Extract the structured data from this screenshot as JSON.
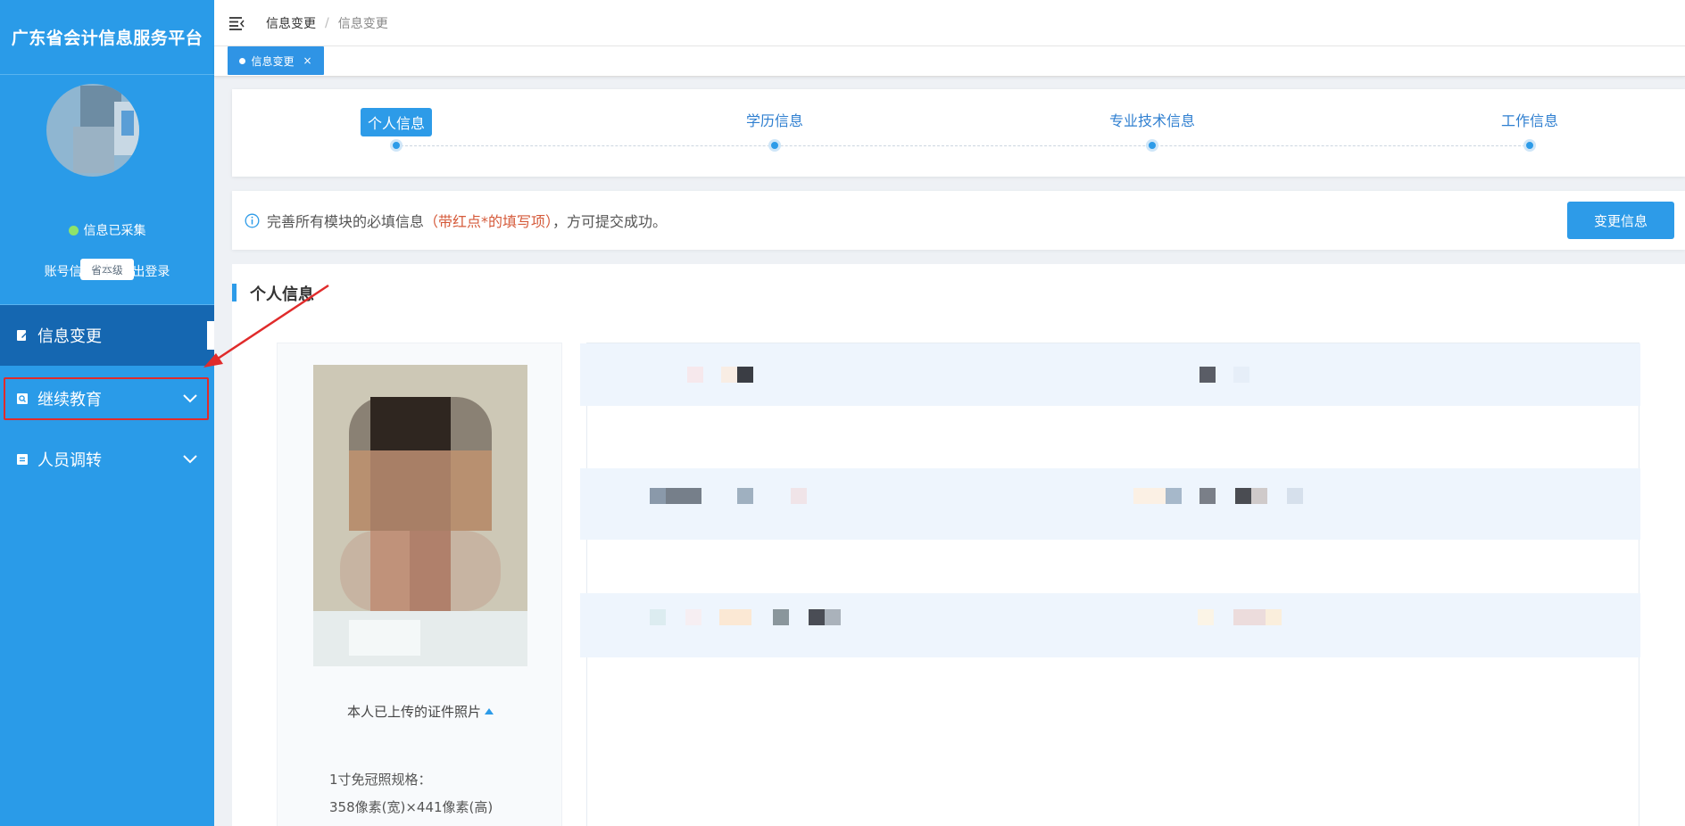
{
  "app": {
    "title": "广东省会计信息服务平台"
  },
  "profile": {
    "level": "省本级",
    "status": "信息已采集",
    "account_link": "账号信息",
    "separator": "|",
    "logout_link": "退出登录"
  },
  "sidebar": {
    "items": [
      {
        "label": "信息变更",
        "icon": "edit-icon",
        "active": true
      },
      {
        "label": "继续教育",
        "icon": "search-doc-icon",
        "active": false,
        "expandable": true
      },
      {
        "label": "人员调转",
        "icon": "list-doc-icon",
        "active": false,
        "expandable": true
      }
    ]
  },
  "topbar": {
    "menu_icon": "menu-fold-icon",
    "breadcrumb": [
      "信息变更",
      "信息变更"
    ],
    "breadcrumb_separator": "/"
  },
  "tabs": [
    {
      "label": "信息变更",
      "close": "×"
    }
  ],
  "steps": [
    {
      "label": "个人信息",
      "active": true
    },
    {
      "label": "学历信息",
      "active": false
    },
    {
      "label": "专业技术信息",
      "active": false
    },
    {
      "label": "工作信息",
      "active": false
    }
  ],
  "notice": {
    "icon": "info-circle-icon",
    "text_before": "完善所有模块的必填信息",
    "text_red": "（带红点*的填写项）",
    "text_after": "，方可提交成功。",
    "button": "变更信息"
  },
  "section": {
    "title": "个人信息",
    "photo_caption": "本人已上传的证件照片",
    "spec_line1": "1寸免冠照规格：",
    "spec_line2": "358像素(宽)×441像素(高)"
  },
  "colors": {
    "sidebar_bg": "#2a9be8",
    "sidebar_active": "#1567b1",
    "primary": "#2d9be8",
    "highlight": "#e02b2b",
    "notice_red": "#d55a3a",
    "status_dot": "#8ee36a"
  }
}
